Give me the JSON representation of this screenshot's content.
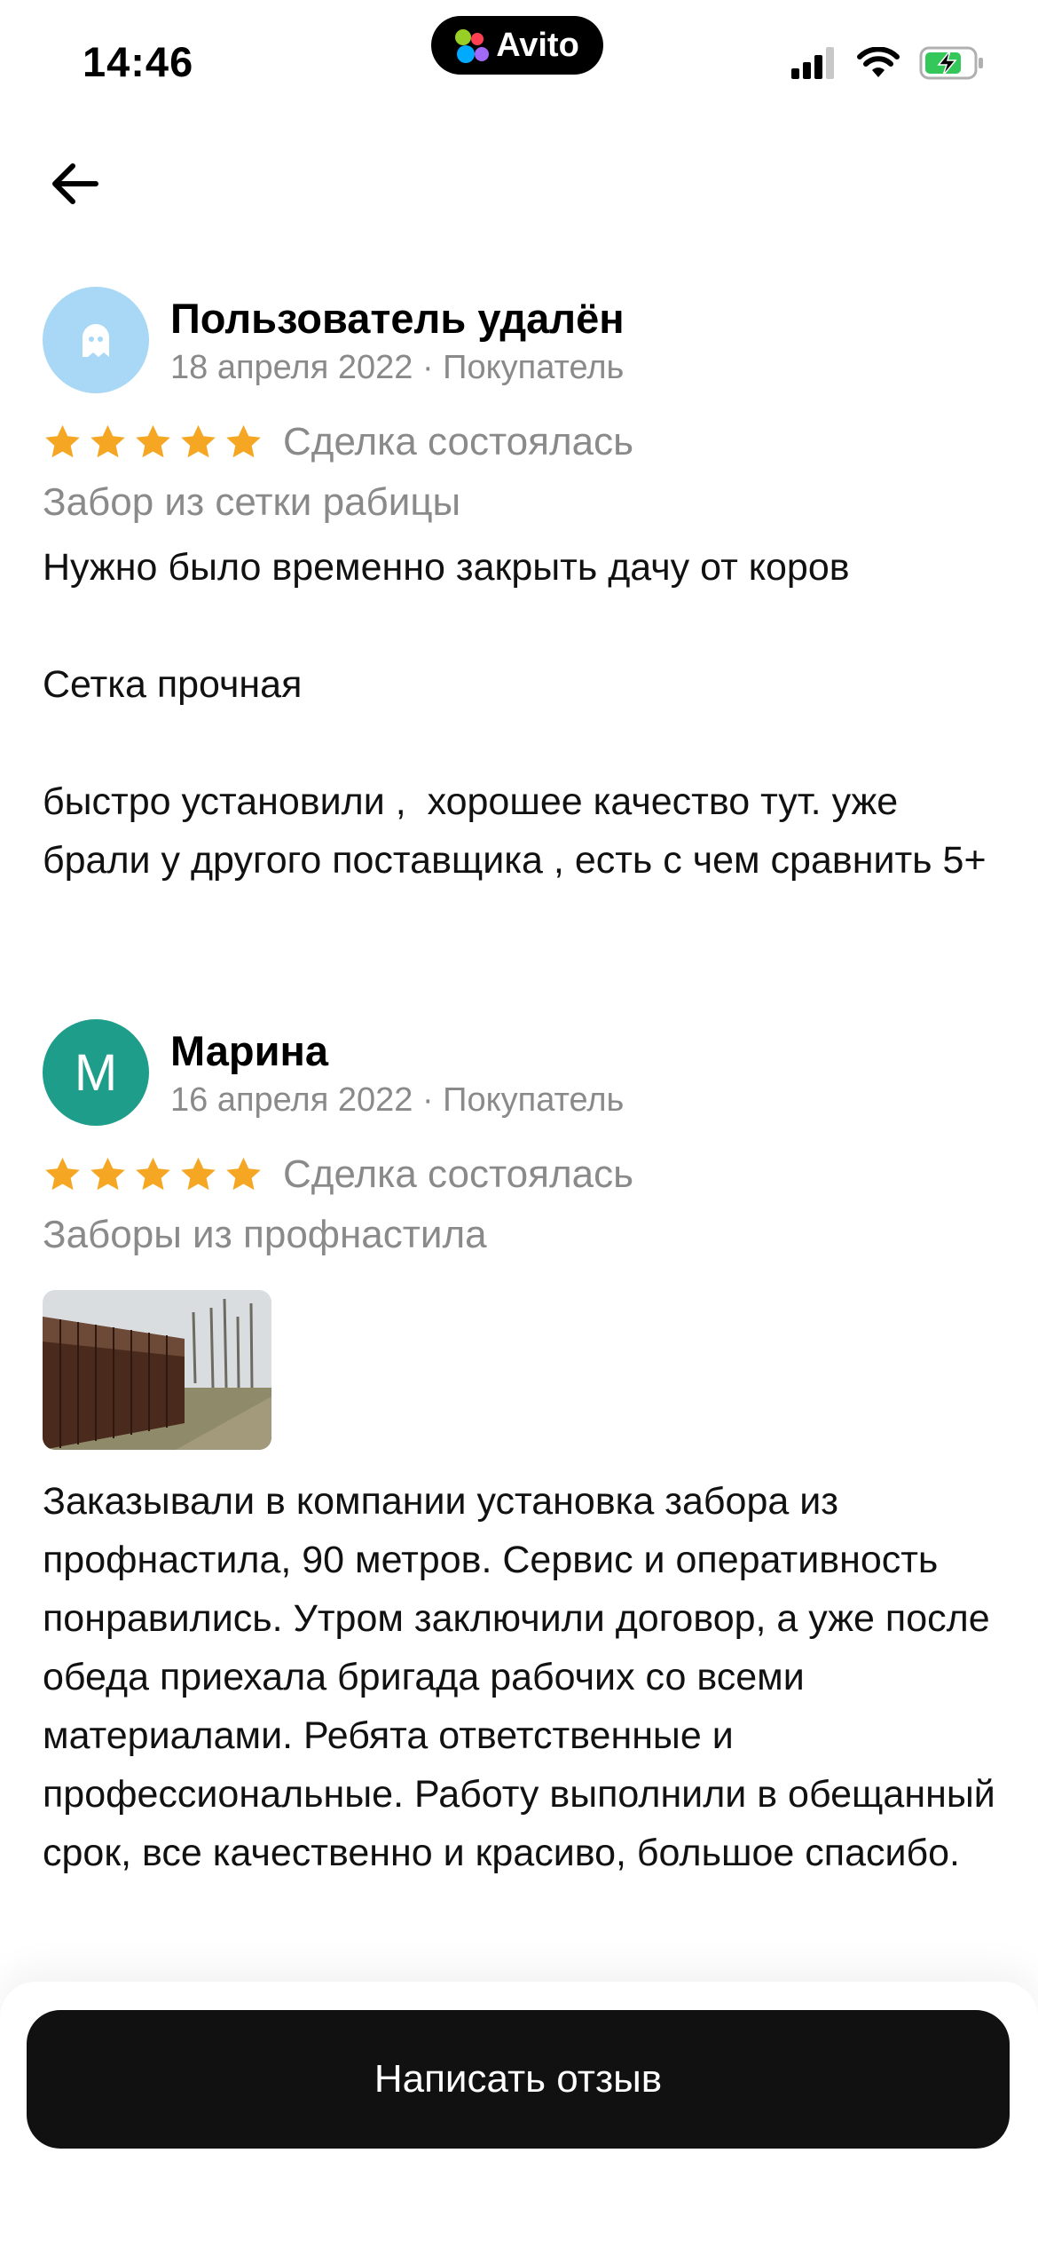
{
  "status_bar": {
    "time": "14:46",
    "island_label": "Avito",
    "icons": [
      "signal-icon",
      "wifi-icon",
      "battery-charging-icon"
    ]
  },
  "navigation": {
    "back_icon": "arrow-left-icon"
  },
  "reviews": [
    {
      "author": "Пользователь удалён",
      "meta": "18 апреля 2022 · Покупатель",
      "avatar_type": "ghost-icon",
      "avatar_color": "#a8d8f5",
      "rating": 5,
      "deal_status": "Сделка состоялась",
      "service": "Забор из сетки рабицы",
      "text": "Нужно было временно закрыть дачу от коров\n\nСетка прочная\n\nбыстро установили ,  хорошее качество тут. уже брали у другого поставщика , есть с чем сравнить 5+"
    },
    {
      "author": "Марина",
      "meta": "16 апреля 2022 · Покупатель",
      "avatar_letter": "M",
      "avatar_color": "#1e9e8a",
      "rating": 5,
      "deal_status": "Сделка состоялась",
      "service": "Заборы из профнастила",
      "photo": "fence-photo",
      "text": "Заказывали в компании установка забора из профнастила, 90 метров. Сервис и оперативность понравились. Утром заключили договор, а уже после обеда приехала бригада рабочих со всеми материалами. Ребята ответственные и профессиональные. Работу выполнили в обещанный срок, все качественно и красиво, большое спасибо."
    }
  ],
  "footer": {
    "write_review_label": "Написать отзыв"
  },
  "colors": {
    "star": "#f5a623",
    "muted": "#8a8a8a",
    "button": "#111111"
  }
}
